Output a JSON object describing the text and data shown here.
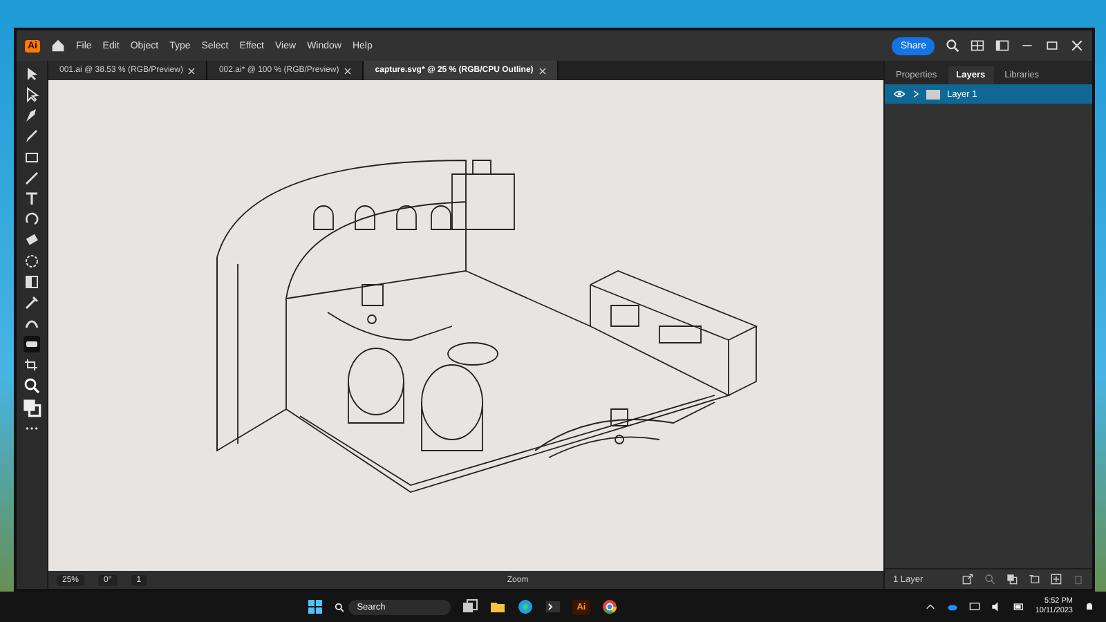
{
  "app_logo": "Ai",
  "menu": [
    "File",
    "Edit",
    "Object",
    "Type",
    "Select",
    "Effect",
    "View",
    "Window",
    "Help"
  ],
  "share_button": "Share",
  "document_tabs": [
    {
      "label": "001.ai @ 38.53 % (RGB/Preview)",
      "selected": false
    },
    {
      "label": "002.ai* @ 100 % (RGB/Preview)",
      "selected": false
    },
    {
      "label": "capture.svg* @ 25 % (RGB/CPU Outline)",
      "selected": true
    }
  ],
  "panel_tabs": [
    {
      "label": "Properties",
      "selected": false
    },
    {
      "label": "Layers",
      "selected": true
    },
    {
      "label": "Libraries",
      "selected": false
    }
  ],
  "layers": [
    {
      "name": "Layer 1",
      "visible": true,
      "selected": true
    }
  ],
  "status_bar": {
    "zoom": "25%",
    "rotation": "0°",
    "artboard": "1",
    "tool": "Zoom"
  },
  "panel_footer": "1 Layer",
  "taskbar": {
    "search_placeholder": "Search",
    "app_label": "Ai",
    "time": "5:52 PM",
    "date": "10/11/2023"
  }
}
